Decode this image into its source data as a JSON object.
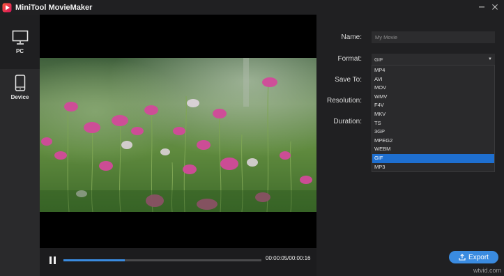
{
  "app": {
    "title": "MiniTool MovieMaker",
    "accent": "#3a8be0"
  },
  "window": {
    "minimize_icon": "minimize-icon",
    "close_icon": "close-icon"
  },
  "nav": {
    "items": [
      {
        "label": "PC",
        "icon": "monitor-icon",
        "active": true
      },
      {
        "label": "Device",
        "icon": "phone-icon",
        "active": false
      }
    ]
  },
  "player": {
    "time": "00:00:05/00:00:16",
    "progress": 0.31
  },
  "settings": {
    "name_label": "Name:",
    "name_value": "My Movie",
    "format_label": "Format:",
    "format_value": "GIF",
    "save_to_label": "Save To:",
    "resolution_label": "Resolution:",
    "duration_label": "Duration:",
    "format_options": [
      "MP4",
      "AVI",
      "MOV",
      "WMV",
      "F4V",
      "MKV",
      "TS",
      "3GP",
      "MPEG2",
      "WEBM",
      "GIF",
      "MP3"
    ],
    "selected_option": "GIF"
  },
  "export": {
    "label": "Export"
  },
  "watermark": "wtvid.com"
}
